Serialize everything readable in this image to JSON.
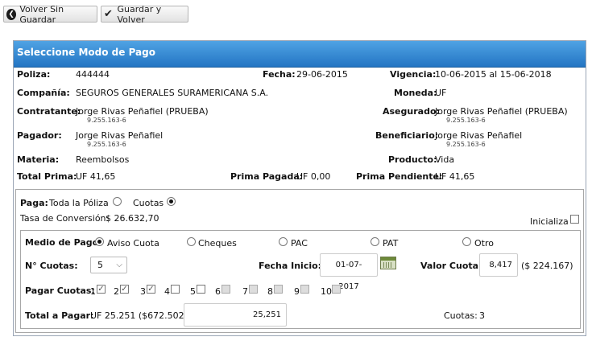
{
  "toolbar": {
    "back_no_save": "Volver Sin Guardar",
    "save_and_back": "Guardar y Volver"
  },
  "panel": {
    "title": "Seleccione Modo de Pago"
  },
  "info": {
    "poliza_label": "Poliza:",
    "poliza_value": "444444",
    "fecha_label": "Fecha:",
    "fecha_value": "29-06-2015",
    "vigencia_label": "Vigencia:",
    "vigencia_value": "10-06-2015 al 15-06-2018",
    "compania_label": "Compañía:",
    "compania_value": "SEGUROS GENERALES SURAMERICANA S.A.",
    "moneda_label": "Moneda:",
    "moneda_value": "UF",
    "contratante_label": "Contratante:",
    "contratante_value": "Jorge Rivas Peñafiel (PRUEBA)",
    "contratante_rut": "9.255.163-6",
    "asegurado_label": "Asegurado:",
    "asegurado_value": "Jorge Rivas Peñafiel (PRUEBA)",
    "asegurado_rut": "9.255.163-6",
    "pagador_label": "Pagador:",
    "pagador_value": "Jorge Rivas Peñafiel",
    "pagador_rut": "9.255.163-6",
    "beneficiario_label": "Beneficiario:",
    "beneficiario_value": "Jorge Rivas Peñafiel",
    "beneficiario_rut": "9.255.163-6",
    "materia_label": "Materia:",
    "materia_value": "Reembolsos",
    "producto_label": "Producto:",
    "producto_value": "Vida",
    "total_prima_label": "Total Prima:",
    "total_prima_value": "UF 41,65",
    "prima_pagada_label": "Prima Pagada:",
    "prima_pagada_value": "UF 0,00",
    "prima_pendiente_label": "Prima Pendiente:",
    "prima_pendiente_value": "UF 41,65"
  },
  "paga": {
    "label": "Paga:",
    "toda_poliza": "Toda la Póliza",
    "cuotas": "Cuotas",
    "selected": "cuotas",
    "tasa_label": "Tasa de Conversión:",
    "tasa_value": "$  26.632,70",
    "inicializa": "Inicializa"
  },
  "medio": {
    "label": "Medio de Pago",
    "options": [
      "Aviso Cuota",
      "Cheques",
      "PAC",
      "PAT",
      "Otro"
    ],
    "selected": "Aviso Cuota",
    "n_cuotas_label": "N° Cuotas:",
    "n_cuotas_value": "5",
    "fecha_inicio_label": "Fecha Inicio:",
    "fecha_inicio_value": "01-07-2017",
    "valor_cuota_label": "Valor Cuota:",
    "valor_cuota_value": "8,417",
    "valor_cuota_clp": "($ 224.167)",
    "pagar_cuotas_label": "Pagar Cuotas:",
    "cuotas_nums": [
      "1",
      "2",
      "3",
      "4",
      "5",
      "6",
      "7",
      "8",
      "9",
      "10"
    ],
    "total_label": "Total a Pagar:",
    "total_value": "UF 25.251 ($672.502)",
    "total_input": "25,251",
    "cuotas_count_label": "Cuotas:",
    "cuotas_count_value": "3"
  }
}
